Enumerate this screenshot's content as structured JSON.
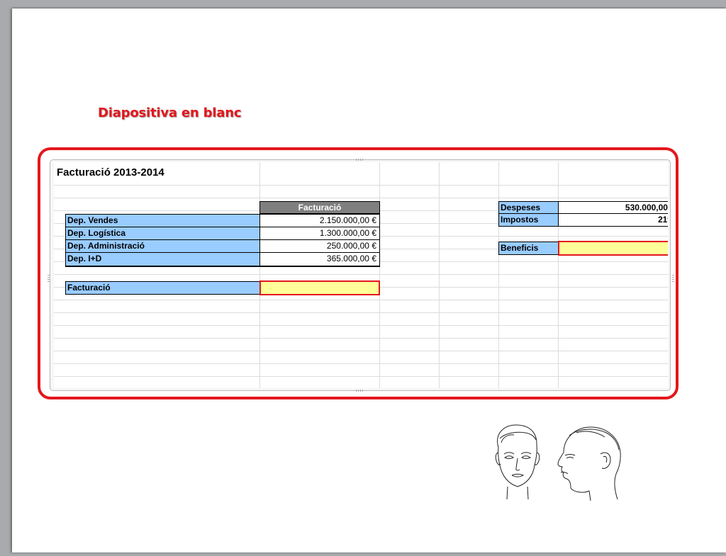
{
  "slide": {
    "title": "Diapositiva en blanc"
  },
  "sheet": {
    "title": "Facturació 2013-2014",
    "column_header": "Facturació",
    "departments": [
      {
        "label": "Dep. Vendes",
        "value": "2.150.000,00 €"
      },
      {
        "label": "Dep. Logística",
        "value": "1.300.000,00 €"
      },
      {
        "label": "Dep. Administració",
        "value": "250.000,00 €"
      },
      {
        "label": "Dep. I+D",
        "value": "365.000,00 €"
      }
    ],
    "total_label": "Facturació",
    "total_value": "",
    "expenses_label": "Despeses",
    "expenses_value": "530.000,00 €",
    "taxes_label": "Impostos",
    "taxes_value": "21%",
    "profit_label": "Beneficis",
    "profit_value": ""
  },
  "colors": {
    "accent_red": "#e3171d",
    "label_blue": "#99ccff",
    "input_yellow": "#ffff99",
    "header_gray": "#7f7f7f"
  },
  "icons": [
    "face-front-illustration",
    "face-profile-illustration"
  ]
}
